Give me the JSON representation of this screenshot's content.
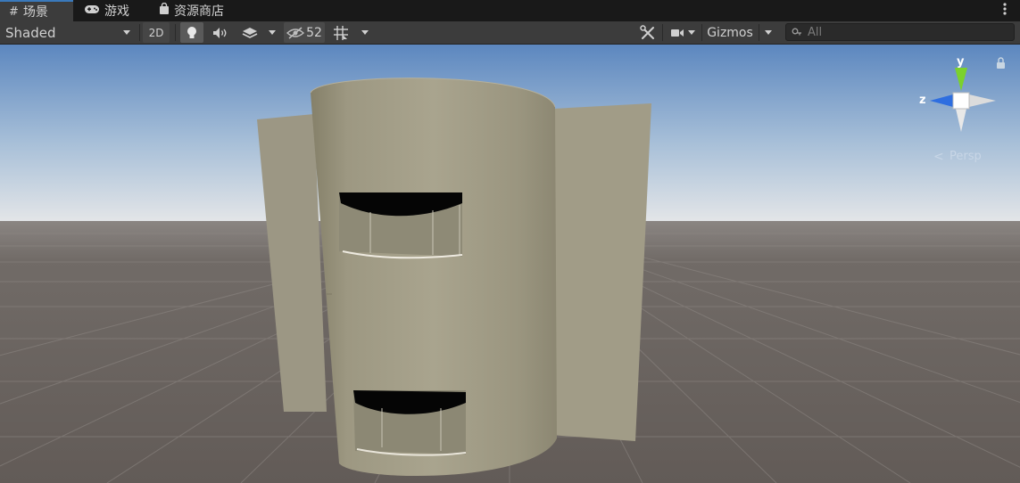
{
  "tabs": [
    {
      "label": "场景",
      "icon": "grid-icon"
    },
    {
      "label": "游戏",
      "icon": "gamepad-icon"
    },
    {
      "label": "资源商店",
      "icon": "shopping-bag-icon"
    }
  ],
  "toolbar": {
    "shading_mode": "Shaded",
    "mode_2d_label": "2D",
    "hidden_count": "52",
    "gizmos_label": "Gizmos",
    "search_placeholder": "All"
  },
  "gizmo": {
    "y_label": "y",
    "z_label": "z",
    "projection_label": "Persp"
  },
  "colors": {
    "tab_active_accent": "#3a79bb",
    "toolbar_bg": "#3c3c3c",
    "sky_top": "#5c87bf",
    "ground": "#66605c",
    "building": "#a19c88",
    "axis_y": "#7bd12c",
    "axis_z": "#2e6ee0"
  }
}
